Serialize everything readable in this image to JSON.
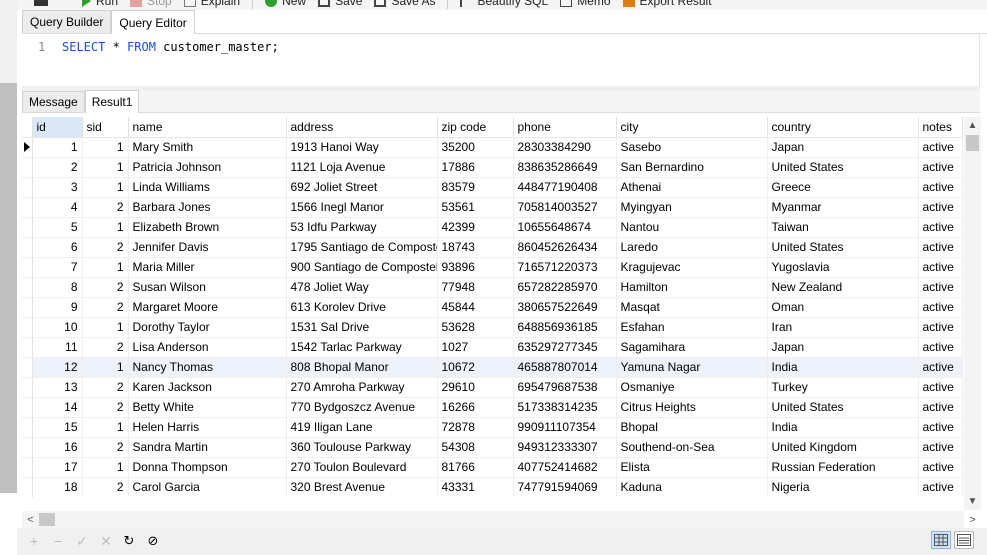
{
  "toolbar": {
    "items": [
      {
        "label": "Run",
        "icon": "play-icon",
        "color": "#2f9e2f"
      },
      {
        "label": "Stop",
        "icon": "stop-icon",
        "color": "#d77"
      },
      {
        "label": "Explain",
        "icon": "explain-icon",
        "color": "#777"
      },
      {
        "label": "New",
        "icon": "new-icon",
        "color": "#2f9e2f"
      },
      {
        "label": "Save",
        "icon": "save-icon",
        "color": "#444"
      },
      {
        "label": "Save As",
        "icon": "save-as-icon",
        "color": "#444"
      },
      {
        "label": "Beautify SQL",
        "icon": "beautify-icon",
        "color": "#444"
      },
      {
        "label": "Memo",
        "icon": "memo-icon",
        "color": "#444"
      },
      {
        "label": "Export Result",
        "icon": "export-icon",
        "color": "#e07b10"
      }
    ]
  },
  "query_tabs": [
    "Query Builder",
    "Query Editor"
  ],
  "editor": {
    "line_number": "1",
    "kw1": "SELECT",
    "rest1": " * ",
    "kw2": "FROM",
    "rest2": " customer_master;"
  },
  "result_tabs": [
    "Message",
    "Result1"
  ],
  "grid": {
    "columns": [
      "id",
      "sid",
      "name",
      "address",
      "zip code",
      "phone",
      "city",
      "country",
      "notes"
    ],
    "rows": [
      [
        "1",
        "1",
        "Mary Smith",
        "1913 Hanoi Way",
        "35200",
        "28303384290",
        "Sasebo",
        "Japan",
        "active"
      ],
      [
        "2",
        "1",
        "Patricia Johnson",
        "1121 Loja Avenue",
        "17886",
        "838635286649",
        "San Bernardino",
        "United States",
        "active"
      ],
      [
        "3",
        "1",
        "Linda Williams",
        "692 Joliet Street",
        "83579",
        "448477190408",
        "Athenai",
        "Greece",
        "active"
      ],
      [
        "4",
        "2",
        "Barbara Jones",
        "1566 Inegl Manor",
        "53561",
        "705814003527",
        "Myingyan",
        "Myanmar",
        "active"
      ],
      [
        "5",
        "1",
        "Elizabeth Brown",
        "53 Idfu Parkway",
        "42399",
        "10655648674",
        "Nantou",
        "Taiwan",
        "active"
      ],
      [
        "6",
        "2",
        "Jennifer Davis",
        "1795 Santiago de Composte",
        "18743",
        "860452626434",
        "Laredo",
        "United States",
        "active"
      ],
      [
        "7",
        "1",
        "Maria Miller",
        "900 Santiago de Composteli",
        "93896",
        "716571220373",
        "Kragujevac",
        "Yugoslavia",
        "active"
      ],
      [
        "8",
        "2",
        "Susan Wilson",
        "478 Joliet Way",
        "77948",
        "657282285970",
        "Hamilton",
        "New Zealand",
        "active"
      ],
      [
        "9",
        "2",
        "Margaret Moore",
        "613 Korolev Drive",
        "45844",
        "380657522649",
        "Masqat",
        "Oman",
        "active"
      ],
      [
        "10",
        "1",
        "Dorothy Taylor",
        "1531 Sal Drive",
        "53628",
        "648856936185",
        "Esfahan",
        "Iran",
        "active"
      ],
      [
        "11",
        "2",
        "Lisa Anderson",
        "1542 Tarlac Parkway",
        "1027",
        "635297277345",
        "Sagamihara",
        "Japan",
        "active"
      ],
      [
        "12",
        "1",
        "Nancy Thomas",
        "808 Bhopal Manor",
        "10672",
        "465887807014",
        "Yamuna Nagar",
        "India",
        "active"
      ],
      [
        "13",
        "2",
        "Karen Jackson",
        "270 Amroha Parkway",
        "29610",
        "695479687538",
        "Osmaniye",
        "Turkey",
        "active"
      ],
      [
        "14",
        "2",
        "Betty White",
        "770 Bydgoszcz Avenue",
        "16266",
        "517338314235",
        "Citrus Heights",
        "United States",
        "active"
      ],
      [
        "15",
        "1",
        "Helen Harris",
        "419 Iligan Lane",
        "72878",
        "990911107354",
        "Bhopal",
        "India",
        "active"
      ],
      [
        "16",
        "2",
        "Sandra Martin",
        "360 Toulouse Parkway",
        "54308",
        "949312333307",
        "Southend-on-Sea",
        "United Kingdom",
        "active"
      ],
      [
        "17",
        "1",
        "Donna Thompson",
        "270 Toulon Boulevard",
        "81766",
        "407752414682",
        "Elista",
        "Russian Federation",
        "active"
      ],
      [
        "18",
        "2",
        "Carol Garcia",
        "320 Brest Avenue",
        "43331",
        "747791594069",
        "Kaduna",
        "Nigeria",
        "active"
      ]
    ],
    "highlight_row": 12,
    "current_row": 1
  }
}
